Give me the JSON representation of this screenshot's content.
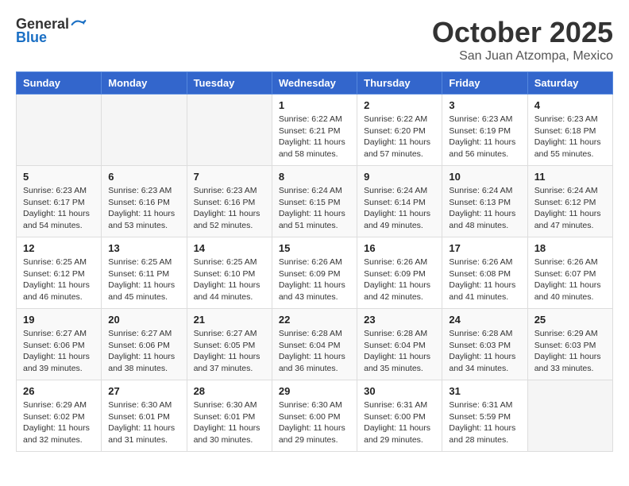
{
  "header": {
    "logo": {
      "general": "General",
      "blue": "Blue"
    },
    "title": "October 2025",
    "location": "San Juan Atzompa, Mexico"
  },
  "days_of_week": [
    "Sunday",
    "Monday",
    "Tuesday",
    "Wednesday",
    "Thursday",
    "Friday",
    "Saturday"
  ],
  "weeks": [
    [
      {
        "day": "",
        "info": ""
      },
      {
        "day": "",
        "info": ""
      },
      {
        "day": "",
        "info": ""
      },
      {
        "day": "1",
        "info": "Sunrise: 6:22 AM\nSunset: 6:21 PM\nDaylight: 11 hours and 58 minutes."
      },
      {
        "day": "2",
        "info": "Sunrise: 6:22 AM\nSunset: 6:20 PM\nDaylight: 11 hours and 57 minutes."
      },
      {
        "day": "3",
        "info": "Sunrise: 6:23 AM\nSunset: 6:19 PM\nDaylight: 11 hours and 56 minutes."
      },
      {
        "day": "4",
        "info": "Sunrise: 6:23 AM\nSunset: 6:18 PM\nDaylight: 11 hours and 55 minutes."
      }
    ],
    [
      {
        "day": "5",
        "info": "Sunrise: 6:23 AM\nSunset: 6:17 PM\nDaylight: 11 hours and 54 minutes."
      },
      {
        "day": "6",
        "info": "Sunrise: 6:23 AM\nSunset: 6:16 PM\nDaylight: 11 hours and 53 minutes."
      },
      {
        "day": "7",
        "info": "Sunrise: 6:23 AM\nSunset: 6:16 PM\nDaylight: 11 hours and 52 minutes."
      },
      {
        "day": "8",
        "info": "Sunrise: 6:24 AM\nSunset: 6:15 PM\nDaylight: 11 hours and 51 minutes."
      },
      {
        "day": "9",
        "info": "Sunrise: 6:24 AM\nSunset: 6:14 PM\nDaylight: 11 hours and 49 minutes."
      },
      {
        "day": "10",
        "info": "Sunrise: 6:24 AM\nSunset: 6:13 PM\nDaylight: 11 hours and 48 minutes."
      },
      {
        "day": "11",
        "info": "Sunrise: 6:24 AM\nSunset: 6:12 PM\nDaylight: 11 hours and 47 minutes."
      }
    ],
    [
      {
        "day": "12",
        "info": "Sunrise: 6:25 AM\nSunset: 6:12 PM\nDaylight: 11 hours and 46 minutes."
      },
      {
        "day": "13",
        "info": "Sunrise: 6:25 AM\nSunset: 6:11 PM\nDaylight: 11 hours and 45 minutes."
      },
      {
        "day": "14",
        "info": "Sunrise: 6:25 AM\nSunset: 6:10 PM\nDaylight: 11 hours and 44 minutes."
      },
      {
        "day": "15",
        "info": "Sunrise: 6:26 AM\nSunset: 6:09 PM\nDaylight: 11 hours and 43 minutes."
      },
      {
        "day": "16",
        "info": "Sunrise: 6:26 AM\nSunset: 6:09 PM\nDaylight: 11 hours and 42 minutes."
      },
      {
        "day": "17",
        "info": "Sunrise: 6:26 AM\nSunset: 6:08 PM\nDaylight: 11 hours and 41 minutes."
      },
      {
        "day": "18",
        "info": "Sunrise: 6:26 AM\nSunset: 6:07 PM\nDaylight: 11 hours and 40 minutes."
      }
    ],
    [
      {
        "day": "19",
        "info": "Sunrise: 6:27 AM\nSunset: 6:06 PM\nDaylight: 11 hours and 39 minutes."
      },
      {
        "day": "20",
        "info": "Sunrise: 6:27 AM\nSunset: 6:06 PM\nDaylight: 11 hours and 38 minutes."
      },
      {
        "day": "21",
        "info": "Sunrise: 6:27 AM\nSunset: 6:05 PM\nDaylight: 11 hours and 37 minutes."
      },
      {
        "day": "22",
        "info": "Sunrise: 6:28 AM\nSunset: 6:04 PM\nDaylight: 11 hours and 36 minutes."
      },
      {
        "day": "23",
        "info": "Sunrise: 6:28 AM\nSunset: 6:04 PM\nDaylight: 11 hours and 35 minutes."
      },
      {
        "day": "24",
        "info": "Sunrise: 6:28 AM\nSunset: 6:03 PM\nDaylight: 11 hours and 34 minutes."
      },
      {
        "day": "25",
        "info": "Sunrise: 6:29 AM\nSunset: 6:03 PM\nDaylight: 11 hours and 33 minutes."
      }
    ],
    [
      {
        "day": "26",
        "info": "Sunrise: 6:29 AM\nSunset: 6:02 PM\nDaylight: 11 hours and 32 minutes."
      },
      {
        "day": "27",
        "info": "Sunrise: 6:30 AM\nSunset: 6:01 PM\nDaylight: 11 hours and 31 minutes."
      },
      {
        "day": "28",
        "info": "Sunrise: 6:30 AM\nSunset: 6:01 PM\nDaylight: 11 hours and 30 minutes."
      },
      {
        "day": "29",
        "info": "Sunrise: 6:30 AM\nSunset: 6:00 PM\nDaylight: 11 hours and 29 minutes."
      },
      {
        "day": "30",
        "info": "Sunrise: 6:31 AM\nSunset: 6:00 PM\nDaylight: 11 hours and 29 minutes."
      },
      {
        "day": "31",
        "info": "Sunrise: 6:31 AM\nSunset: 5:59 PM\nDaylight: 11 hours and 28 minutes."
      },
      {
        "day": "",
        "info": ""
      }
    ]
  ]
}
